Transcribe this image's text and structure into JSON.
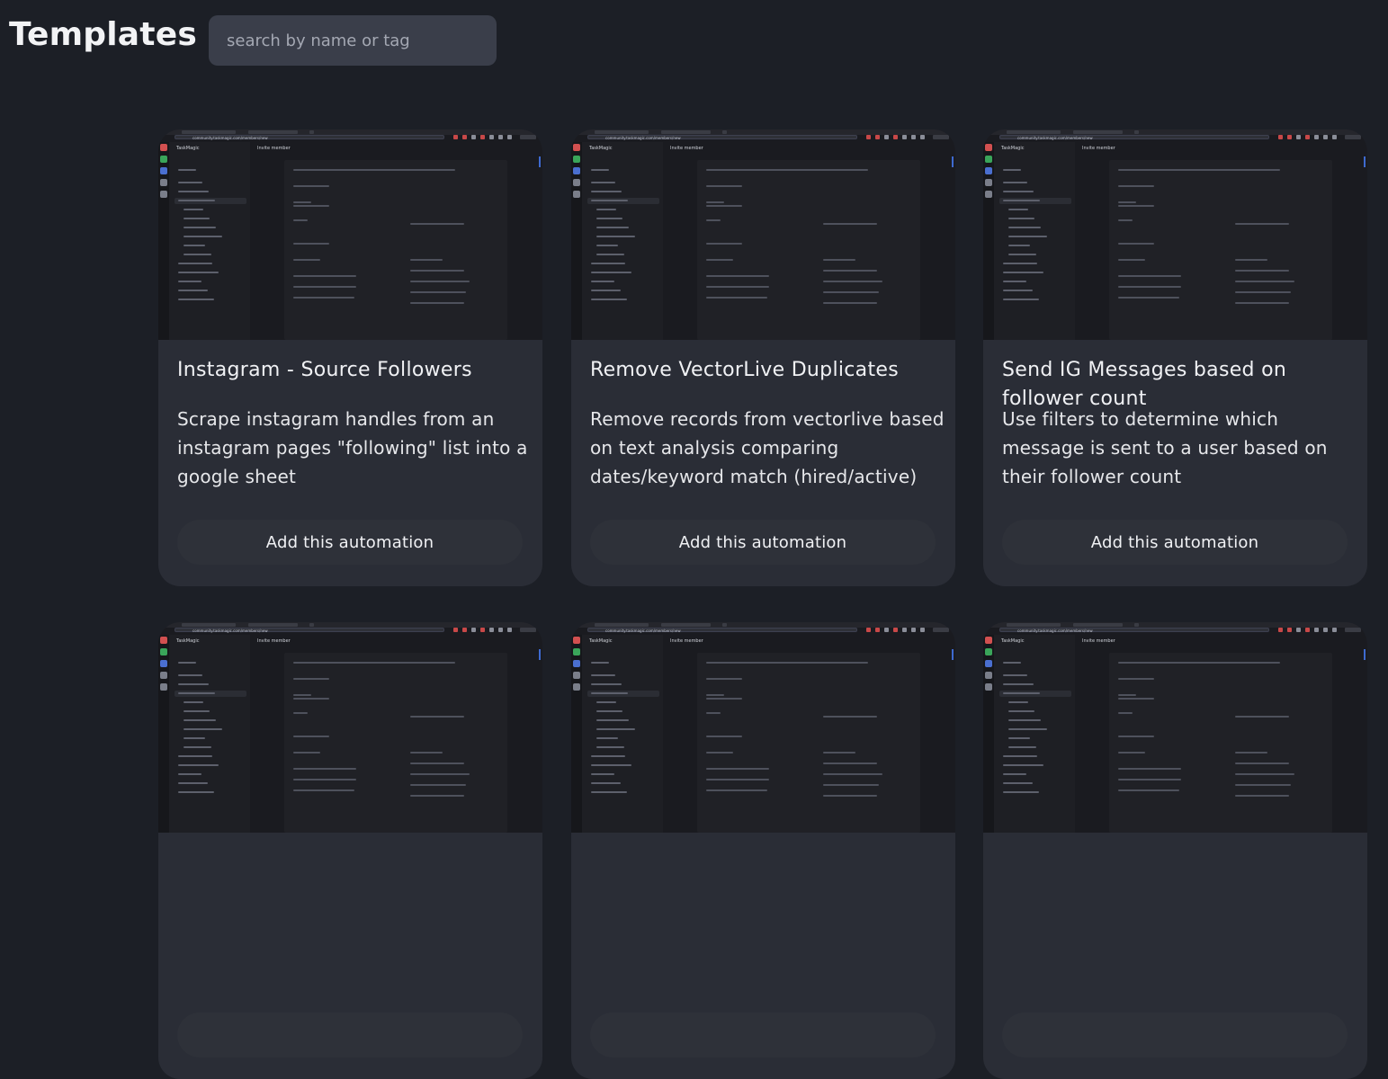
{
  "header": {
    "title": "Templates",
    "search_placeholder": "search by name or tag"
  },
  "thumbnail": {
    "brand": "TaskMagic",
    "heading": "Invite member",
    "url": "community.taskmagic.com/members/new"
  },
  "cards": [
    {
      "title": "Instagram - Source Followers",
      "description": "Scrape instagram handles from an instagram pages \"following\" list into a google sheet",
      "button": "Add this automation"
    },
    {
      "title": "Remove VectorLive Duplicates",
      "description": "Remove records from vectorlive based on text analysis comparing dates/keyword match (hired/active)",
      "button": "Add this automation"
    },
    {
      "title": "Send IG Messages based on follower count",
      "description": "Use filters to determine which message is sent to a user based on their follower count",
      "button": "Add this automation"
    },
    {
      "title": "",
      "description": "",
      "button": ""
    },
    {
      "title": "",
      "description": "",
      "button": ""
    },
    {
      "title": "",
      "description": "",
      "button": ""
    }
  ],
  "colors": {
    "background": "#1c1f26",
    "card": "#2a2d36",
    "search": "#3a3e4a",
    "accent_blue": "#3e6ad0"
  }
}
